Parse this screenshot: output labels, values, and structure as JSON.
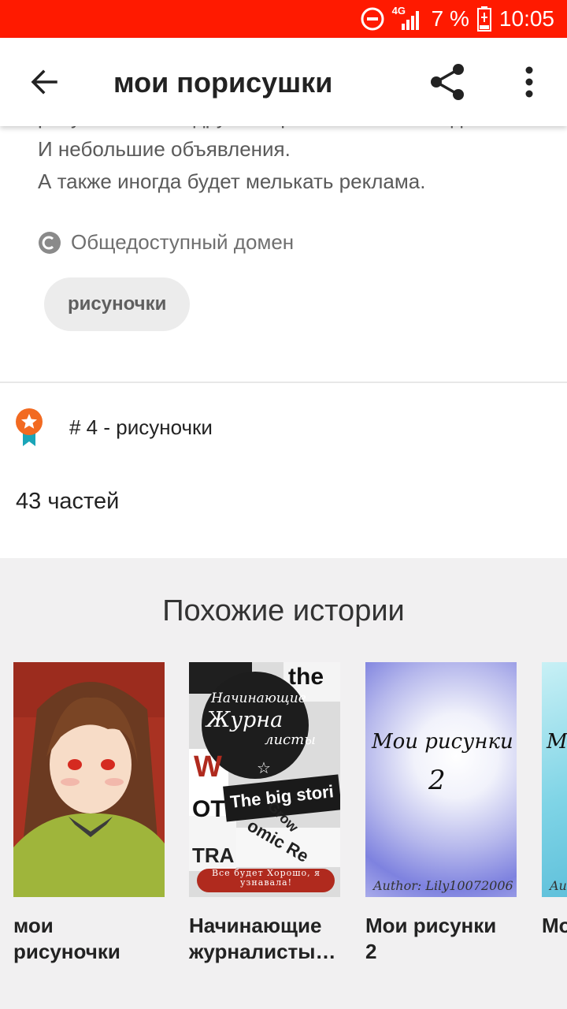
{
  "status_bar": {
    "network": "4G",
    "battery_percent": "7 %",
    "time": "10:05",
    "colors": {
      "background": "#ff1a00",
      "text": "#ffffff"
    },
    "icons": [
      "do-not-disturb-icon",
      "signal-icon",
      "battery-charging-icon"
    ]
  },
  "app_bar": {
    "title": "мои порисушки",
    "icons": [
      "back-arrow-icon",
      "share-icon",
      "more-vertical-icon"
    ]
  },
  "description": {
    "partial_line": "рисунки моих подруг которых нет на ваттпад.",
    "lines": [
      "И небольшие объявления.",
      "А также иногда будет мелькать реклама."
    ]
  },
  "license": {
    "label": "Общедоступный домен",
    "icon": "public-domain-icon"
  },
  "tag": {
    "label": "рисуночки"
  },
  "ranking": {
    "label": "# 4 - рисуночки",
    "icon": "award-badge-icon",
    "color": "#f26a21"
  },
  "parts": {
    "label": "43 частей"
  },
  "similar": {
    "title": "Похожие истории",
    "items": [
      {
        "title_line1": "мои",
        "title_line2": "рисуночки"
      },
      {
        "title_line1": "Начинающие",
        "title_line2": "журналисты…",
        "cover_text": {
          "top": "Начинающие",
          "middle": "Журна",
          "bottom": "листы",
          "headline": "The big stori",
          "banner": "Все будет Хорошо, я узнавала!",
          "scrap1": "the",
          "scrap2": "omic Re",
          "scrap3": "Grow",
          "scrap4": "OT",
          "scrap5": "TRA",
          "scrap6": "W"
        }
      },
      {
        "title_line1": "Мои рисунки",
        "title_line2": "2",
        "cover_text": {
          "title": "Мои рисунки",
          "number": "2",
          "author": "Author: Lily10072006"
        }
      },
      {
        "title_line1": "Мо",
        "title_line2": "",
        "cover_text": {
          "title": "М",
          "author": "Au"
        }
      }
    ]
  }
}
